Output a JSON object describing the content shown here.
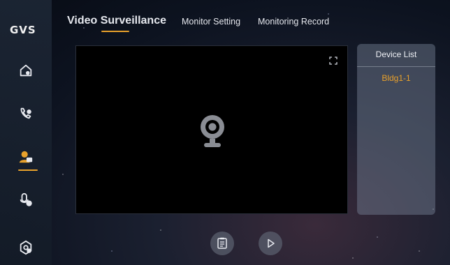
{
  "brand": {
    "logo_text": "GVS"
  },
  "header": {
    "tabs": [
      {
        "label": "Video Surveillance",
        "active": true
      },
      {
        "label": "Monitor Setting",
        "active": false
      },
      {
        "label": "Monitoring Record",
        "active": false
      }
    ]
  },
  "sidebar": {
    "items": [
      {
        "icon": "home-icon",
        "active": false
      },
      {
        "icon": "phone-icon",
        "active": false
      },
      {
        "icon": "user-camera-icon",
        "active": true
      },
      {
        "icon": "microphone-icon",
        "active": false
      },
      {
        "icon": "settings-icon",
        "active": false
      }
    ]
  },
  "device_panel": {
    "title": "Device List",
    "devices": [
      {
        "name": "Bldg1-1",
        "selected": true
      }
    ]
  },
  "video": {
    "placeholder_icon": "webcam-icon",
    "fullscreen_icon": "fullscreen-icon"
  },
  "controls": [
    {
      "icon": "record-list-icon"
    },
    {
      "icon": "play-icon"
    }
  ],
  "colors": {
    "accent": "#e8a12b",
    "text": "#e6e8ee",
    "video_bg": "#000000"
  }
}
